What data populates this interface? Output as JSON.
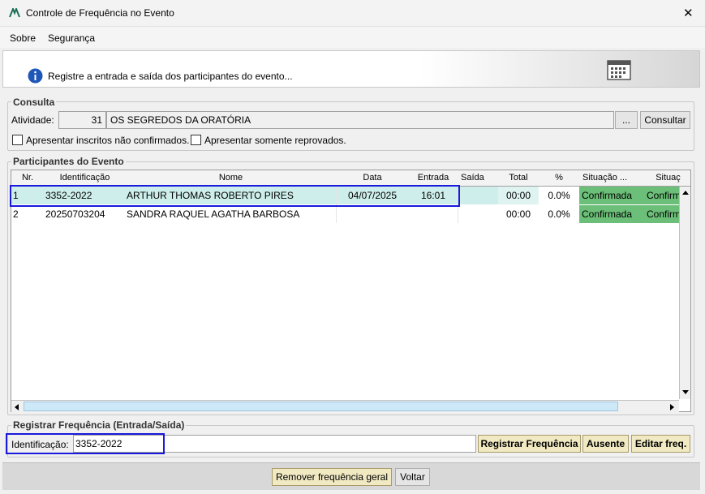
{
  "window": {
    "title": "Controle de Frequência no Evento",
    "close_glyph": "✕"
  },
  "menu": {
    "items": [
      "Sobre",
      "Segurança"
    ]
  },
  "banner": {
    "text": "Registre a entrada e saída dos participantes do evento..."
  },
  "consulta": {
    "title": "Consulta",
    "atividade_label": "Atividade:",
    "atividade_code": "31",
    "atividade_name": "OS SEGREDOS DA ORATÓRIA",
    "browse_label": "...",
    "consultar_label": "Consultar",
    "chk_nao_confirmados": "Apresentar inscritos não confirmados.",
    "chk_reprovados": "Apresentar somente reprovados."
  },
  "participantes": {
    "title": "Participantes do Evento",
    "columns": [
      "Nr.",
      "Identificação",
      "Nome",
      "Data",
      "Entrada",
      "Saída",
      "Total",
      "%",
      "Situação ...",
      "Situaç"
    ],
    "rows": [
      {
        "nr": "1",
        "ident": "3352-2022",
        "nome": "ARTHUR THOMAS ROBERTO PIRES",
        "data": "04/07/2025",
        "entrada": "16:01",
        "saida": "",
        "total": "00:00",
        "pct": "0.0%",
        "sit1": "Confirmada",
        "sit2": "Confirm"
      },
      {
        "nr": "2",
        "ident": "20250703204",
        "nome": "SANDRA RAQUEL AGATHA BARBOSA",
        "data": "",
        "entrada": "",
        "saida": "",
        "total": "00:00",
        "pct": "0.0%",
        "sit1": "Confirmada",
        "sit2": "Confirm"
      }
    ]
  },
  "registrar": {
    "title": "Registrar Frequência (Entrada/Saída)",
    "ident_label": "Identificação:",
    "ident_value": "3352-2022",
    "btn_registrar": "Registrar Frequência",
    "btn_ausente": "Ausente",
    "btn_editar": "Editar freq."
  },
  "footer": {
    "btn_remover": "Remover frequência geral",
    "btn_voltar": "Voltar"
  },
  "colors": {
    "selected_row": "#cdeeea",
    "green_status": "#6bbf78",
    "highlight_border": "#1a1adc"
  }
}
